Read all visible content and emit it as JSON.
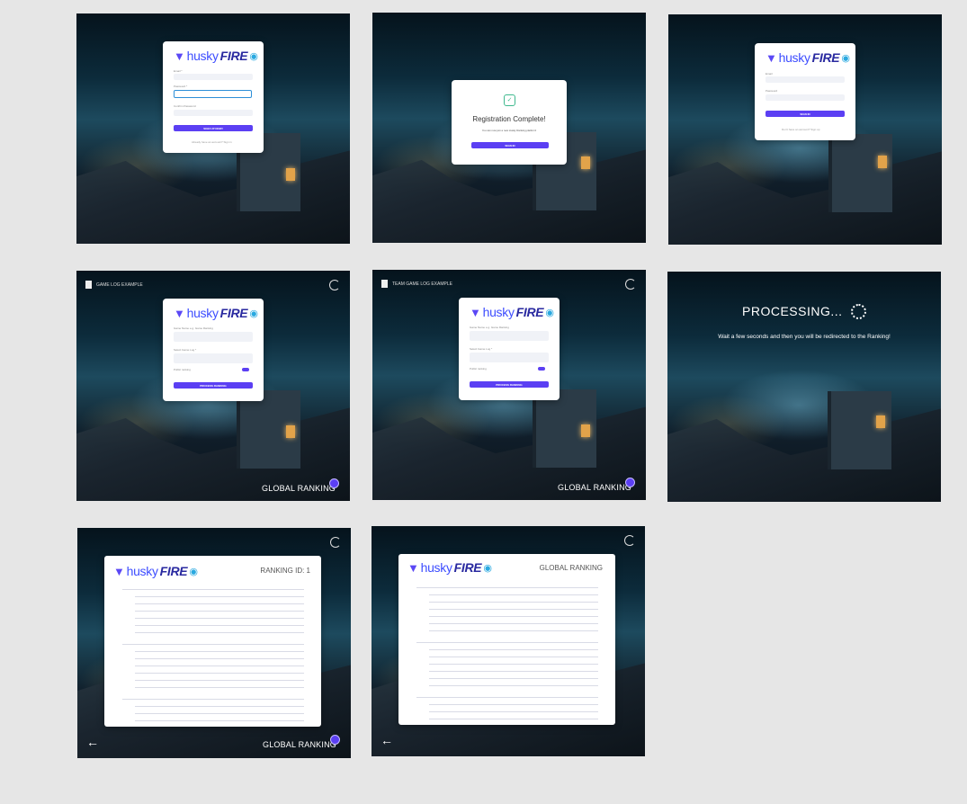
{
  "brand": {
    "husky": "husky",
    "fire": "FIRE"
  },
  "icons": {
    "logo": "husky-head-icon",
    "drop": "fire-drop-icon",
    "doc": "document-icon",
    "logout": "logout-icon",
    "back": "arrow-left-icon",
    "check": "check-circle-icon",
    "spinner": "spinner-icon",
    "badge": "ranking-badge-icon"
  },
  "register": {
    "email_label": "Email *",
    "password_label": "Password *",
    "confirm_label": "Confirm Password",
    "button": "SIGN UP NOW!",
    "footer": "Already have an account? Sign in"
  },
  "complete": {
    "title": "Registration Complete!",
    "message": "You can now join a new Husky Ranking platform!",
    "button": "SIGN IN"
  },
  "signin": {
    "email_label": "Email",
    "password_label": "Password",
    "button": "SIGN IN",
    "footer": "Don't have an account? Sign up"
  },
  "game_log": {
    "link": "GAME LOG EXAMPLE",
    "team_link": "TEAM GAME LOG EXAMPLE",
    "name_label": "Game Name",
    "name_placeholder": "e.g. Game Ranking",
    "file_label": "Select Game Log *",
    "toggle_label": "Public ranking",
    "button": "PROCESS RANKING"
  },
  "global_ranking": "GLOBAL RANKING",
  "processing": {
    "title": "PROCESSING...",
    "message": "Wait a few seconds and then you will be redirected to the Ranking!"
  },
  "ranking": {
    "title_id": "RANKING ID: 1",
    "title_global": "GLOBAL RANKING"
  },
  "colors": {
    "accent": "#5b3ff3",
    "background": "#e6e6e6"
  }
}
